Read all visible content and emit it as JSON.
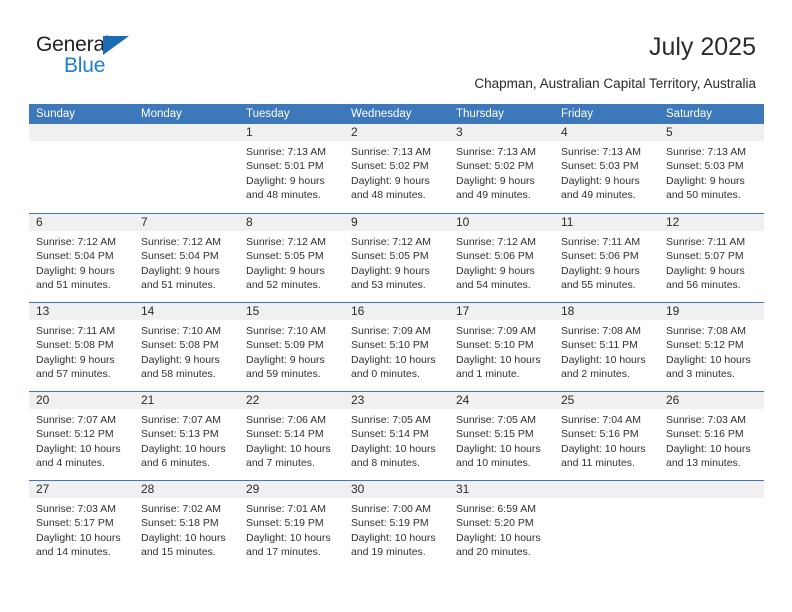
{
  "brand": {
    "name_top": "General",
    "name_bottom": "Blue",
    "accent_color": "#1b7fd4",
    "triangle_color": "#1b6cb5"
  },
  "header": {
    "title": "July 2025",
    "subtitle": "Chapman, Australian Capital Territory, Australia"
  },
  "theme": {
    "header_row_bg": "#3d78ba",
    "header_row_text": "#ffffff",
    "day_band_bg": "#f0f0f0",
    "row_divider": "#3d78ba",
    "body_text": "#303030"
  },
  "weekdays": [
    "Sunday",
    "Monday",
    "Tuesday",
    "Wednesday",
    "Thursday",
    "Friday",
    "Saturday"
  ],
  "weeks": [
    [
      {
        "day": "",
        "lines": []
      },
      {
        "day": "",
        "lines": []
      },
      {
        "day": "1",
        "lines": [
          "Sunrise: 7:13 AM",
          "Sunset: 5:01 PM",
          "Daylight: 9 hours and 48 minutes."
        ]
      },
      {
        "day": "2",
        "lines": [
          "Sunrise: 7:13 AM",
          "Sunset: 5:02 PM",
          "Daylight: 9 hours and 48 minutes."
        ]
      },
      {
        "day": "3",
        "lines": [
          "Sunrise: 7:13 AM",
          "Sunset: 5:02 PM",
          "Daylight: 9 hours and 49 minutes."
        ]
      },
      {
        "day": "4",
        "lines": [
          "Sunrise: 7:13 AM",
          "Sunset: 5:03 PM",
          "Daylight: 9 hours and 49 minutes."
        ]
      },
      {
        "day": "5",
        "lines": [
          "Sunrise: 7:13 AM",
          "Sunset: 5:03 PM",
          "Daylight: 9 hours and 50 minutes."
        ]
      }
    ],
    [
      {
        "day": "6",
        "lines": [
          "Sunrise: 7:12 AM",
          "Sunset: 5:04 PM",
          "Daylight: 9 hours and 51 minutes."
        ]
      },
      {
        "day": "7",
        "lines": [
          "Sunrise: 7:12 AM",
          "Sunset: 5:04 PM",
          "Daylight: 9 hours and 51 minutes."
        ]
      },
      {
        "day": "8",
        "lines": [
          "Sunrise: 7:12 AM",
          "Sunset: 5:05 PM",
          "Daylight: 9 hours and 52 minutes."
        ]
      },
      {
        "day": "9",
        "lines": [
          "Sunrise: 7:12 AM",
          "Sunset: 5:05 PM",
          "Daylight: 9 hours and 53 minutes."
        ]
      },
      {
        "day": "10",
        "lines": [
          "Sunrise: 7:12 AM",
          "Sunset: 5:06 PM",
          "Daylight: 9 hours and 54 minutes."
        ]
      },
      {
        "day": "11",
        "lines": [
          "Sunrise: 7:11 AM",
          "Sunset: 5:06 PM",
          "Daylight: 9 hours and 55 minutes."
        ]
      },
      {
        "day": "12",
        "lines": [
          "Sunrise: 7:11 AM",
          "Sunset: 5:07 PM",
          "Daylight: 9 hours and 56 minutes."
        ]
      }
    ],
    [
      {
        "day": "13",
        "lines": [
          "Sunrise: 7:11 AM",
          "Sunset: 5:08 PM",
          "Daylight: 9 hours and 57 minutes."
        ]
      },
      {
        "day": "14",
        "lines": [
          "Sunrise: 7:10 AM",
          "Sunset: 5:08 PM",
          "Daylight: 9 hours and 58 minutes."
        ]
      },
      {
        "day": "15",
        "lines": [
          "Sunrise: 7:10 AM",
          "Sunset: 5:09 PM",
          "Daylight: 9 hours and 59 minutes."
        ]
      },
      {
        "day": "16",
        "lines": [
          "Sunrise: 7:09 AM",
          "Sunset: 5:10 PM",
          "Daylight: 10 hours and 0 minutes."
        ]
      },
      {
        "day": "17",
        "lines": [
          "Sunrise: 7:09 AM",
          "Sunset: 5:10 PM",
          "Daylight: 10 hours and 1 minute."
        ]
      },
      {
        "day": "18",
        "lines": [
          "Sunrise: 7:08 AM",
          "Sunset: 5:11 PM",
          "Daylight: 10 hours and 2 minutes."
        ]
      },
      {
        "day": "19",
        "lines": [
          "Sunrise: 7:08 AM",
          "Sunset: 5:12 PM",
          "Daylight: 10 hours and 3 minutes."
        ]
      }
    ],
    [
      {
        "day": "20",
        "lines": [
          "Sunrise: 7:07 AM",
          "Sunset: 5:12 PM",
          "Daylight: 10 hours and 4 minutes."
        ]
      },
      {
        "day": "21",
        "lines": [
          "Sunrise: 7:07 AM",
          "Sunset: 5:13 PM",
          "Daylight: 10 hours and 6 minutes."
        ]
      },
      {
        "day": "22",
        "lines": [
          "Sunrise: 7:06 AM",
          "Sunset: 5:14 PM",
          "Daylight: 10 hours and 7 minutes."
        ]
      },
      {
        "day": "23",
        "lines": [
          "Sunrise: 7:05 AM",
          "Sunset: 5:14 PM",
          "Daylight: 10 hours and 8 minutes."
        ]
      },
      {
        "day": "24",
        "lines": [
          "Sunrise: 7:05 AM",
          "Sunset: 5:15 PM",
          "Daylight: 10 hours and 10 minutes."
        ]
      },
      {
        "day": "25",
        "lines": [
          "Sunrise: 7:04 AM",
          "Sunset: 5:16 PM",
          "Daylight: 10 hours and 11 minutes."
        ]
      },
      {
        "day": "26",
        "lines": [
          "Sunrise: 7:03 AM",
          "Sunset: 5:16 PM",
          "Daylight: 10 hours and 13 minutes."
        ]
      }
    ],
    [
      {
        "day": "27",
        "lines": [
          "Sunrise: 7:03 AM",
          "Sunset: 5:17 PM",
          "Daylight: 10 hours and 14 minutes."
        ]
      },
      {
        "day": "28",
        "lines": [
          "Sunrise: 7:02 AM",
          "Sunset: 5:18 PM",
          "Daylight: 10 hours and 15 minutes."
        ]
      },
      {
        "day": "29",
        "lines": [
          "Sunrise: 7:01 AM",
          "Sunset: 5:19 PM",
          "Daylight: 10 hours and 17 minutes."
        ]
      },
      {
        "day": "30",
        "lines": [
          "Sunrise: 7:00 AM",
          "Sunset: 5:19 PM",
          "Daylight: 10 hours and 19 minutes."
        ]
      },
      {
        "day": "31",
        "lines": [
          "Sunrise: 6:59 AM",
          "Sunset: 5:20 PM",
          "Daylight: 10 hours and 20 minutes."
        ]
      },
      {
        "day": "",
        "lines": []
      },
      {
        "day": "",
        "lines": []
      }
    ]
  ]
}
